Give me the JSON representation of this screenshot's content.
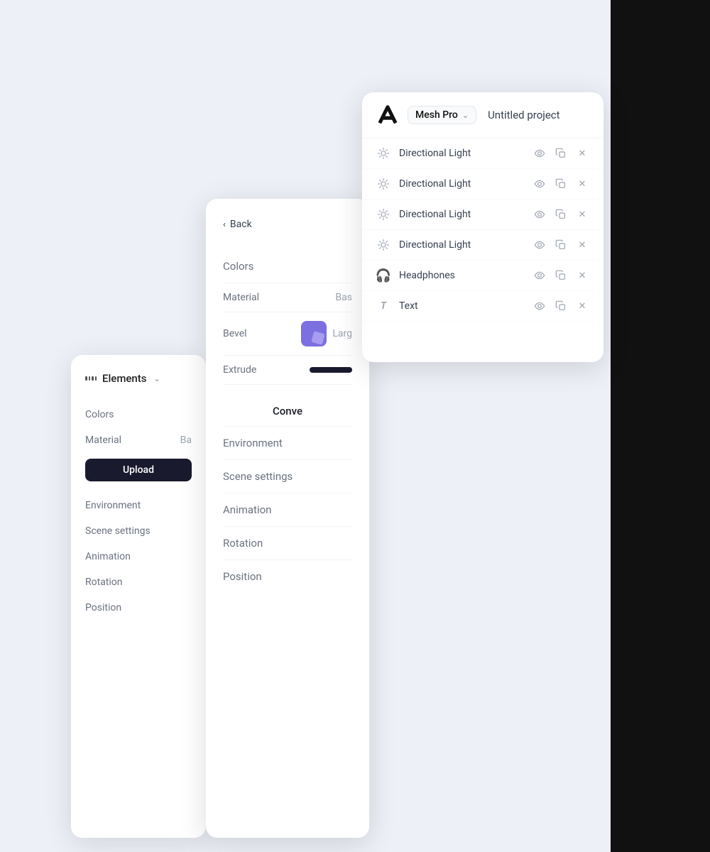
{
  "app": {
    "title": "Mesh Pro",
    "product": "Mesh Pro",
    "project": "Untitled project"
  },
  "leftPanel": {
    "elements_label": "Elements",
    "nav_items": [
      {
        "label": "Colors"
      },
      {
        "label": "Material",
        "value": "Ba"
      },
      {
        "label": "Upload"
      },
      {
        "label": "Environment"
      },
      {
        "label": "Scene settings"
      },
      {
        "label": "Animation"
      },
      {
        "label": "Rotation"
      },
      {
        "label": "Position"
      }
    ]
  },
  "midPanel": {
    "back_label": "Back",
    "sections": [
      {
        "label": "Colors"
      },
      {
        "label": "Material",
        "value": "Bas"
      },
      {
        "label": "Bevel",
        "value": "Larg"
      },
      {
        "label": "Extrude"
      },
      {
        "label": "Convert"
      },
      {
        "label": "Environment"
      },
      {
        "label": "Scene settings"
      },
      {
        "label": "Animation"
      },
      {
        "label": "Rotation"
      },
      {
        "label": "Position"
      }
    ]
  },
  "mainPanel": {
    "scene_items": [
      {
        "type": "light",
        "name": "Directional Light"
      },
      {
        "type": "light",
        "name": "Directional Light"
      },
      {
        "type": "light",
        "name": "Directional Light"
      },
      {
        "type": "light",
        "name": "Directional Light"
      },
      {
        "type": "headphones",
        "name": "Headphones"
      },
      {
        "type": "text",
        "name": "Text"
      }
    ]
  },
  "icons": {
    "eye": "◎",
    "copy": "⧉",
    "close": "✕",
    "back_chevron": "‹",
    "down_chevron": "⌄"
  }
}
